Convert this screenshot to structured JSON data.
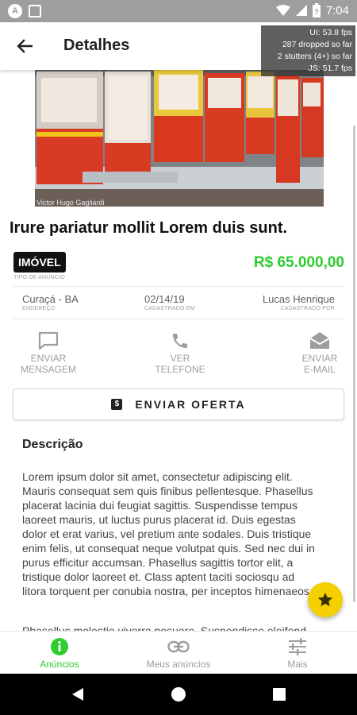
{
  "status_bar": {
    "time": "7:04",
    "left_icons": [
      "a-circle-icon",
      "square-notification-icon"
    ],
    "right_icons": [
      "wifi-icon",
      "cell-signal-icon",
      "battery-icon"
    ]
  },
  "app_bar": {
    "title": "Detalhes",
    "back_icon": "arrow-left-icon"
  },
  "perf_overlay": {
    "lines": [
      "UI: 53.8 fps",
      "287 dropped so far",
      "2 stutters (4+) so far",
      "JS: 51.7 fps"
    ]
  },
  "listing": {
    "photo_credit": "Victor Hugo Gagliardi",
    "title": "Irure pariatur mollit Lorem duis sunt.",
    "type": "IMÓVEL",
    "type_caption": "TIPO DE ANÚNCIO",
    "price": "R$ 65.000,00",
    "location": "Curaçá - BA",
    "location_caption": "ENDEREÇO",
    "date": "02/14/19",
    "date_caption": "CADASTRADO EM",
    "author": "Lucas Henrique",
    "author_caption": "CADASTRADO POR"
  },
  "actions": {
    "message": "ENVIAR\nMENSAGEM",
    "phone": "VER\nTELEFONE",
    "email": "ENVIAR\nE-MAIL"
  },
  "offer_button": {
    "label": "ENVIAR OFERTA",
    "icon_glyph": "$"
  },
  "description": {
    "heading": "Descrição",
    "paragraph1": "Lorem ipsum dolor sit amet, consectetur adipiscing elit. Mauris consequat sem quis finibus pellentesque. Phasellus placerat lacinia dui feugiat sagittis. Suspendisse tempus laoreet mauris, ut luctus purus placerat id. Duis egestas dolor et erat varius, vel pretium ante sodales. Duis tristique enim felis, ut consequat neque volutpat quis. Sed nec dui in purus efficitur accumsan. Phasellus sagittis tortor elit, a tristique dolor laoreet et. Class aptent taciti sociosqu ad litora torquent per conubia nostra, per inceptos himenaeos.",
    "paragraph2": "Phasellus molestie viverra posuere. Suspendisse eleifend"
  },
  "bottom_nav": {
    "items": [
      {
        "label": "Anúncios",
        "icon": "info-icon",
        "active": true
      },
      {
        "label": "Meus anúncios",
        "icon": "link-icon",
        "active": false
      },
      {
        "label": "Mais",
        "icon": "sliders-icon",
        "active": false
      }
    ]
  },
  "colors": {
    "accent_green": "#2ecc2e",
    "fab_yellow": "#f5d000",
    "status_bar_gray": "#9e9e9e"
  }
}
